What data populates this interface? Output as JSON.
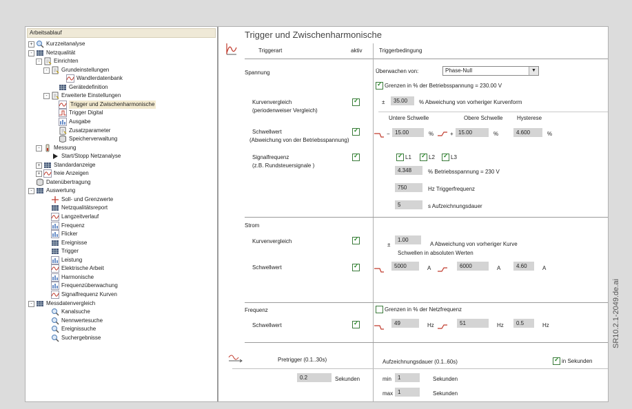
{
  "watermark": "SR10.2.1-2049.de.ai",
  "tree": {
    "header": "Arbeitsablauf",
    "items": [
      "Kurzzeitanalyse",
      "Netzqualität",
      "Einrichten",
      "Grundeinstellungen",
      "Wandlerdatenbank",
      "Gerätedefinition",
      "Erweiterte Einstellungen",
      "Trigger und Zwischenharmonische",
      "Trigger Digital",
      "Ausgabe",
      "Zusatzparameter",
      "Speicherverwaltung",
      "Messung",
      "Start/Stopp Netzanalyse",
      "Standardanzeige",
      "freie Anzeigen",
      "Datenübertragung",
      "Auswertung",
      "Soll- und Grenzwerte",
      "Netzqualitätsreport",
      "Langzeitverlauf",
      "Frequenz",
      "Flicker",
      "Ereignisse",
      "Trigger",
      "Leistung",
      "Elektrische Arbeit",
      "Harmonische",
      "Frequenzüberwachung",
      "Signalfrequenz Kurven",
      "Messdatenvergleich",
      "Kanalsuche",
      "Nennwertesuche",
      "Ereignissuche",
      "Suchergebnisse"
    ]
  },
  "panel": {
    "title": "Trigger und Zwischenharmonische",
    "col_triggerart": "Triggerart",
    "col_aktiv": "aktiv",
    "col_bedingung": "Triggerbedingung",
    "spannung": {
      "label": "Spannung",
      "ueberwachen_label": "Überwachen von:",
      "ueberwachen_value": "Phase-Null",
      "grenzen_label": "Grenzen in % der Betriebsspannung = 230.00 V",
      "kurven_label1": "Kurvenvergleich",
      "kurven_label2": "(periodenweiser Vergleich)",
      "kurven_pm": "±",
      "kurven_value": "35.00",
      "kurven_unit": "% Abweichung von vorheriger Kurvenform",
      "untere": "Untere Schwelle",
      "obere": "Obere Schwelle",
      "hysterese": "Hysterese",
      "schwell_label1": "Schwellwert",
      "schwell_label2": "(Abweichung von der Betriebsspannung)",
      "minus": "−",
      "plus": "+",
      "untere_value": "15.00",
      "obere_value": "15.00",
      "hyst_value": "4.600",
      "pct": "%",
      "signal_label1": "Signalfrequenz",
      "signal_label2": "(z.B. Rundsteuersignale )",
      "l1": "L1",
      "l2": "L2",
      "l3": "L3",
      "sig_value": "4.348",
      "sig_unit": "% Betriebsspannung = 230 V",
      "freq_value": "750",
      "freq_unit": "Hz  Triggerfrequenz",
      "dauer_value": "5",
      "dauer_unit": "s   Aufzeichnungsdauer"
    },
    "strom": {
      "label": "Strom",
      "kurven_label": "Kurvenvergleich",
      "pm": "±",
      "kurven_value": "1.00",
      "kurven_unit": "A  Abweichung von vorheriger Kurve",
      "hint": "Schwellen in absoluten Werten",
      "schwell_label": "Schwellwert",
      "low_value": "5000",
      "high_value": "6000",
      "hyst_value": "4.60",
      "unit": "A"
    },
    "frequenz": {
      "label": "Frequenz",
      "grenzen_label": "Grenzen in % der Netzfrequenz",
      "schwell_label": "Schwellwert",
      "low_value": "49",
      "high_value": "51",
      "hyst_value": "0.5",
      "unit": "Hz"
    },
    "pretrigger": {
      "label": "Pretrigger (0.1..30s)",
      "value": "0.2",
      "unit": "Sekunden",
      "aufz_label": "Aufzeichnungsdauer (0.1..60s)",
      "in_sek": "in Sekunden",
      "min_label": "min",
      "min_value": "1",
      "max_label": "max",
      "max_value": "1",
      "sek": "Sekunden"
    }
  }
}
